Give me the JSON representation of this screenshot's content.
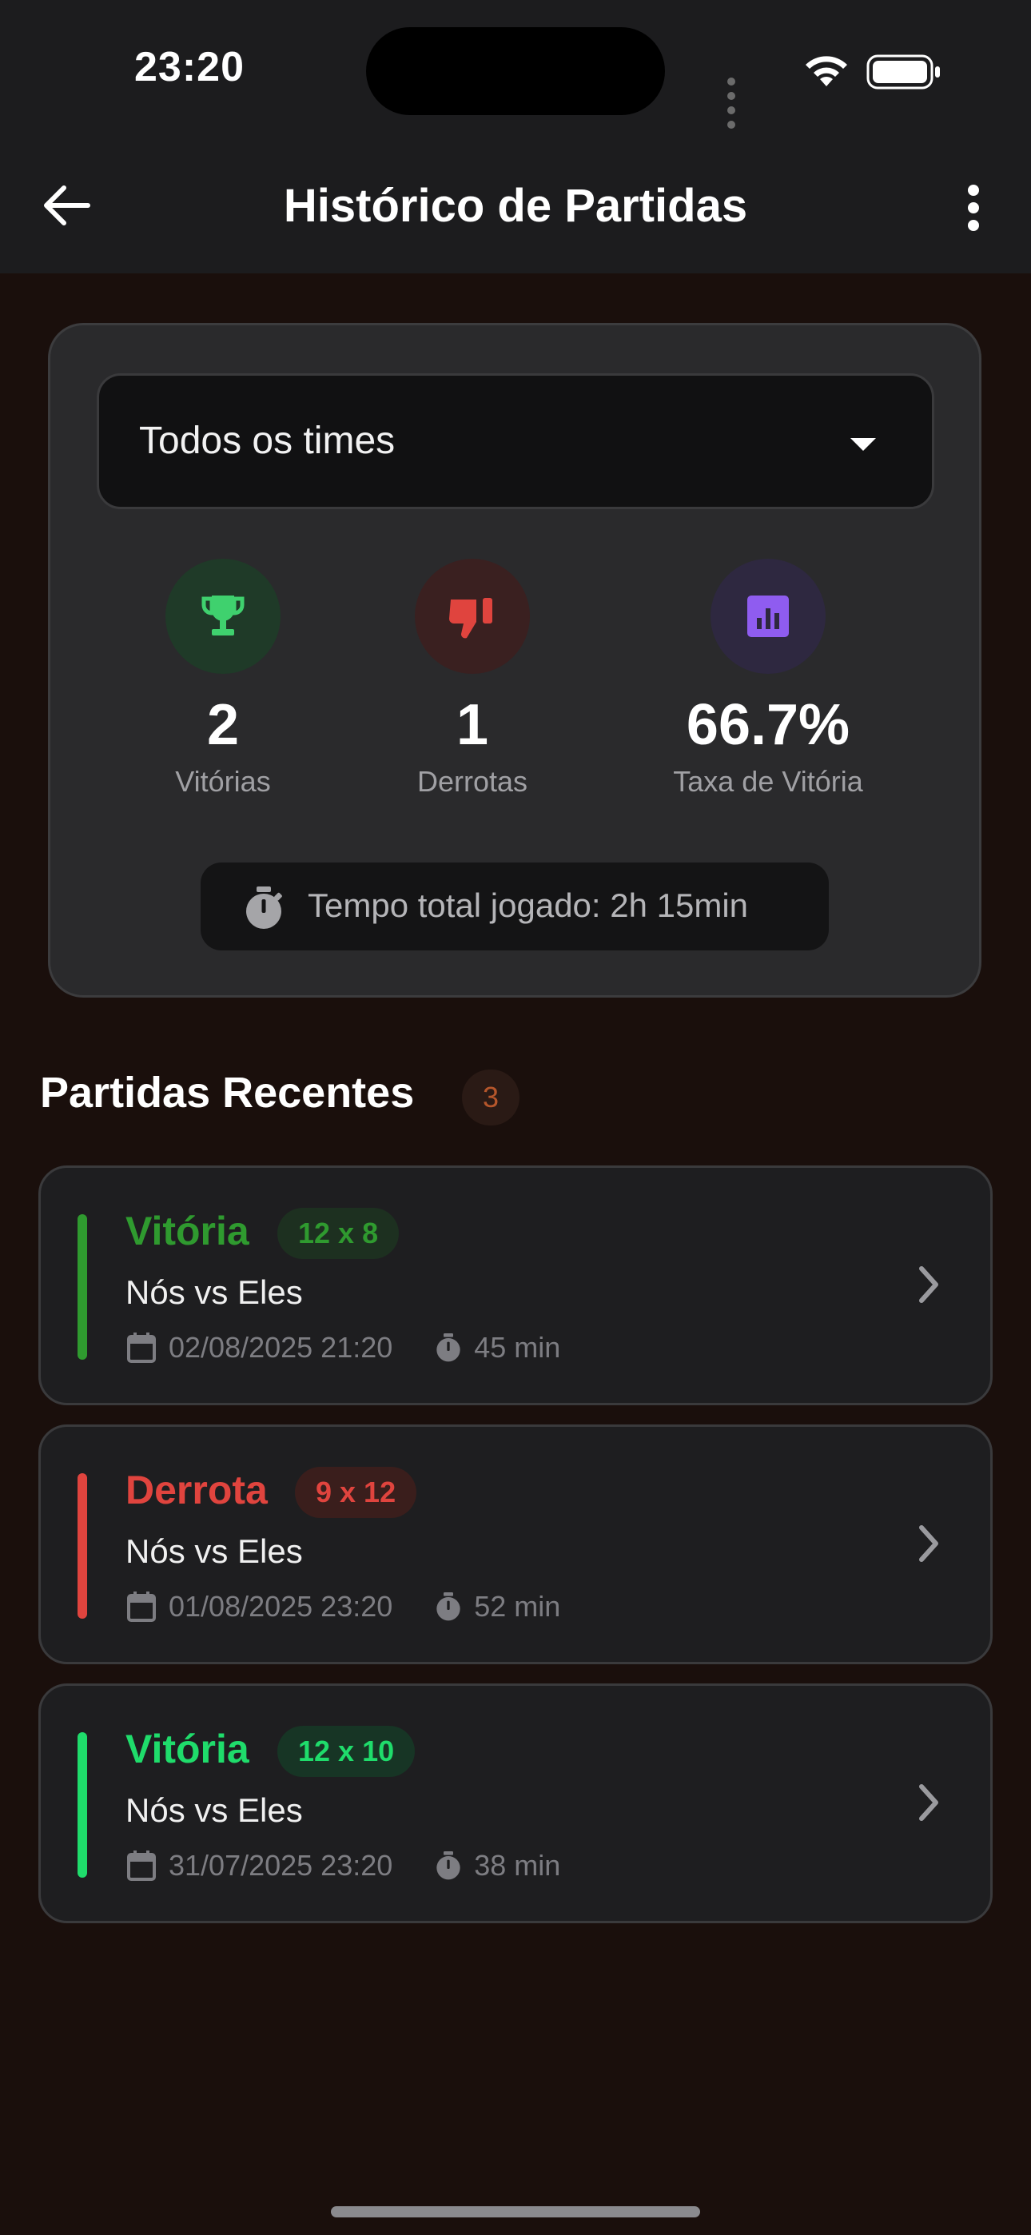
{
  "status_bar": {
    "time": "23:20"
  },
  "header": {
    "title": "Histórico de Partidas"
  },
  "filter": {
    "selected": "Todos os times"
  },
  "stats": {
    "wins": {
      "value": "2",
      "label": "Vitórias",
      "icon": "trophy-icon",
      "color": "#3fd16e"
    },
    "losses": {
      "value": "1",
      "label": "Derrotas",
      "icon": "thumbs-down-icon",
      "color": "#e0443e"
    },
    "win_rate": {
      "value": "66.7%",
      "label": "Taxa de Vitória",
      "icon": "bar-chart-icon",
      "color": "#8f5cf0"
    },
    "total_time": "Tempo total jogado: 2h 15min"
  },
  "recent": {
    "title": "Partidas Recentes",
    "count": "3",
    "matches": [
      {
        "result": "Vitória",
        "score": "12 x 8",
        "teams": "Nós vs Eles",
        "date": "02/08/2025 21:20",
        "duration": "45 min",
        "color": "#2f9a2f"
      },
      {
        "result": "Derrota",
        "score": "9 x 12",
        "teams": "Nós vs Eles",
        "date": "01/08/2025 23:20",
        "duration": "52 min",
        "color": "#e0443e"
      },
      {
        "result": "Vitória",
        "score": "12 x 10",
        "teams": "Nós vs Eles",
        "date": "31/07/2025 23:20",
        "duration": "38 min",
        "color": "#1fdc6b"
      }
    ]
  }
}
